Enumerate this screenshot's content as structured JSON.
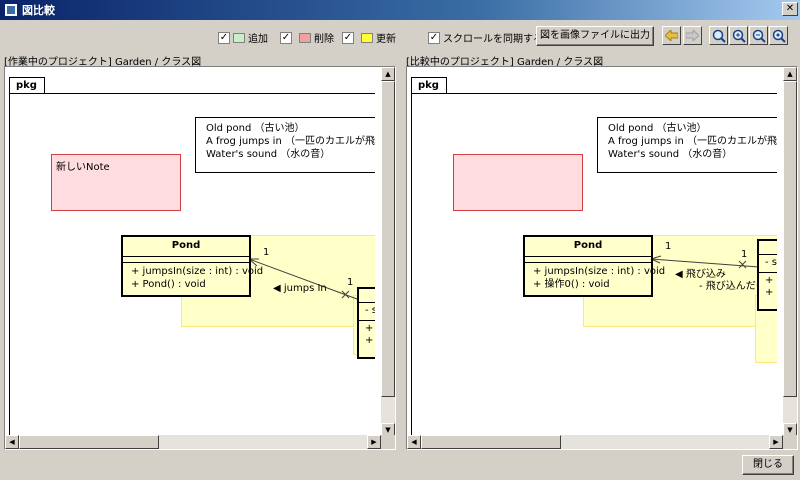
{
  "window": {
    "title": "図比較",
    "close_glyph": "✕"
  },
  "toolbar": {
    "add_label": "追加",
    "delete_label": "削除",
    "update_label": "更新",
    "sync_scroll_label": "スクロールを同期する",
    "export_label": "図を画像ファイルに出力",
    "check_glyph": "✓",
    "colors": {
      "add": "#c8f0c8",
      "delete": "#f0a0a0",
      "update": "#ffff33"
    }
  },
  "left_panel": {
    "header": "[作業中のプロジェクト] Garden / クラス図",
    "pkg": "pkg",
    "textbox_lines": [
      "Old pond （古い池）",
      "A frog jumps in （一匹のカエルが飛び込む）",
      "Water's sound （水の音）"
    ],
    "note_text": "新しいNote",
    "class_name": "Pond",
    "ops": [
      "+ jumpsIn(size : int) : void",
      "+ Pond() : void"
    ],
    "assoc_label": "◀ jumps In",
    "mult_1": "1",
    "mult_2": "1",
    "partial_attr": "- si",
    "partial_ops": [
      "+ s",
      "+ F"
    ]
  },
  "right_panel": {
    "header": "[比較中のプロジェクト] Garden / クラス図",
    "pkg": "pkg",
    "textbox_lines": [
      "Old pond （古い池）",
      "A frog jumps in （一匹のカエルが飛び込む）",
      "Water's sound （水の音）"
    ],
    "class_name": "Pond",
    "ops": [
      "+ jumpsIn(size : int) : void",
      "+ 操作0() : void"
    ],
    "assoc_label": "◀ 飛び込み",
    "assoc_label2": "- 飛び込んだもの",
    "mult_1": "1",
    "mult_2": "1",
    "partial_attr": "- si",
    "partial_ops": [
      "+ st",
      "+ Fr"
    ]
  },
  "footer": {
    "close_label": "閉じる"
  }
}
